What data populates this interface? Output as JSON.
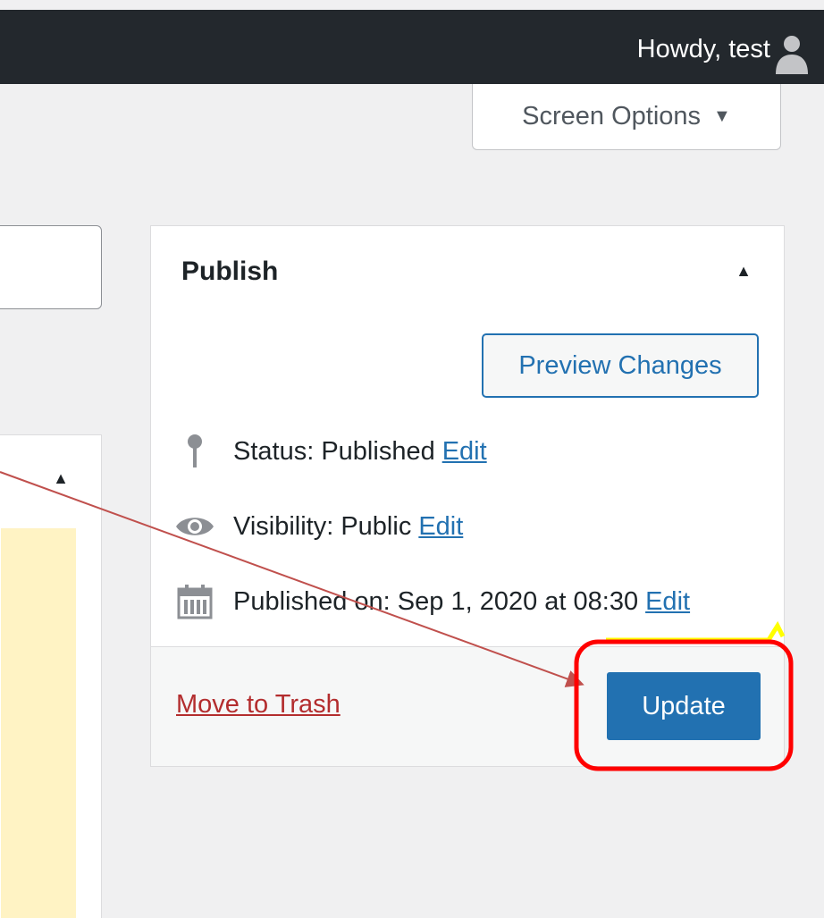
{
  "topbar": {
    "greeting": "Howdy, test",
    "avatar_icon": "user-avatar-icon"
  },
  "screen_options": {
    "label": "Screen Options",
    "arrow": "▼"
  },
  "publish_box": {
    "title": "Publish",
    "collapse_arrow": "▲",
    "preview_label": "Preview Changes",
    "status_text": "Status: Published",
    "status_edit": "Edit",
    "visibility_text": "Visibility: Public",
    "visibility_edit": "Edit",
    "published_text": "Published on: Sep 1, 2020 at 08:30",
    "published_edit": "Edit",
    "trash_label": "Move to Trash",
    "update_label": "Update"
  },
  "left_panel": {
    "collapse_arrow": "▲"
  },
  "colors": {
    "admin_bar": "#23282d",
    "accent": "#2271b1",
    "trash": "#b32d2e",
    "annotation_arrow": "#c0504d",
    "annotation_circle": "#ff0000",
    "highlight": "#ffff00"
  }
}
